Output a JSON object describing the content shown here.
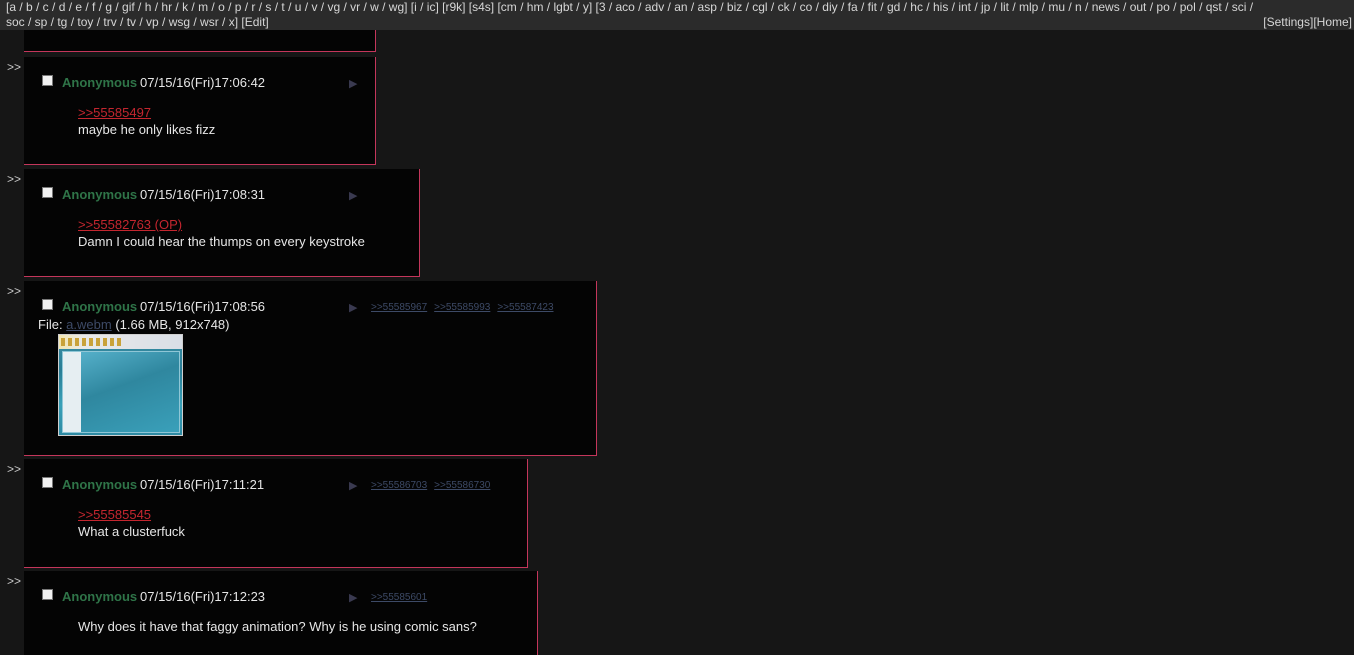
{
  "nav": {
    "line1": "[a / b / c / d / e / f / g / gif / h / hr / k / m / o / p / r / s / t / u / v / vg / vr / w / wg] [i / ic] [r9k] [s4s] [cm / hm / lgbt / y] [3 / aco / adv / an / asp / biz / cgl / ck / co / diy / fa / fit / gd / hc / his / int / jp / lit / mlp / mu / n / news / out / po / pol / qst / sci /",
    "line2": "soc / sp / tg / toy / trv / tv / vp / wsg / wsr / x] [Edit]",
    "settings": "[Settings]",
    "home": "[Home]"
  },
  "side_marker": ">>",
  "posts": [
    {
      "name": "Anonymous",
      "datetime": "07/15/16(Fri)17:06:42",
      "quote": ">>55585497",
      "body": "maybe he only likes fizz",
      "backlinks": []
    },
    {
      "name": "Anonymous",
      "datetime": "07/15/16(Fri)17:08:31",
      "quote": ">>55582763 (OP)",
      "body": "Damn I could hear the thumps on every keystroke",
      "backlinks": []
    },
    {
      "name": "Anonymous",
      "datetime": "07/15/16(Fri)17:08:56",
      "file_label": "File: ",
      "file_name": "a.webm",
      "file_meta": " (1.66 MB, 912x748)",
      "backlinks": [
        ">>55585967",
        ">>55585993",
        ">>55587423"
      ]
    },
    {
      "name": "Anonymous",
      "datetime": "07/15/16(Fri)17:11:21",
      "quote": ">>55585545",
      "body": "What a clusterfuck",
      "backlinks": [
        ">>55586703",
        ">>55586730"
      ]
    },
    {
      "name": "Anonymous",
      "datetime": "07/15/16(Fri)17:12:23",
      "body": "Why does it have that faggy animation? Why is he using comic sans?",
      "backlinks": [
        ">>55585601"
      ]
    }
  ],
  "colors": {
    "border": "#c4365b",
    "name": "#2f7448",
    "quotelink": "#c4262f",
    "background": "#161616",
    "post_bg": "#040404"
  }
}
